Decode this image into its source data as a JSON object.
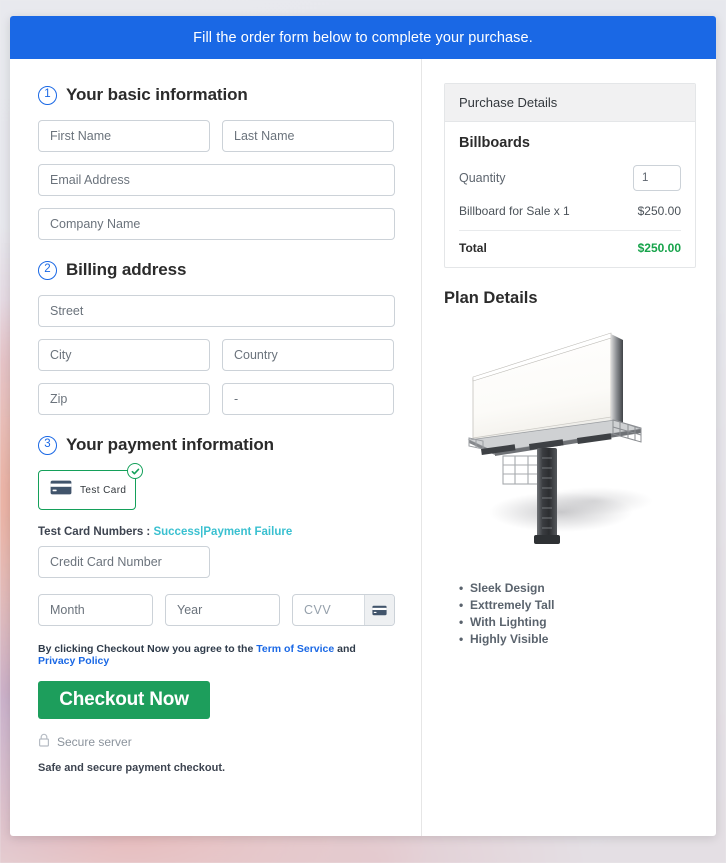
{
  "banner": {
    "text": "Fill the order form below to complete your purchase."
  },
  "sections": {
    "basic": {
      "number": "1",
      "title": "Your basic information",
      "fields": {
        "first_name": "First Name",
        "last_name": "Last Name",
        "email": "Email Address",
        "company": "Company Name"
      }
    },
    "billing": {
      "number": "2",
      "title": "Billing address",
      "fields": {
        "street": "Street",
        "city": "City",
        "country": "Country",
        "zip": "Zip",
        "state": "-"
      }
    },
    "payment": {
      "number": "3",
      "title": "Your payment information",
      "test_card_label": "Test Card",
      "test_card_icon": "credit-card-icon",
      "selected_icon": "check-circle-icon",
      "test_numbers_prefix": "Test Card Numbers :",
      "test_numbers_success": "Success",
      "test_numbers_separator": "|",
      "test_numbers_failure": "Payment Failure",
      "fields": {
        "card_number": "Credit Card Number",
        "month": "Month",
        "year": "Year",
        "cvv": "CVV"
      },
      "cvv_icon": "credit-card-icon"
    }
  },
  "footer": {
    "terms_prefix": "By clicking Checkout Now you agree to the",
    "terms_link": "Term of Service",
    "terms_middle": "and",
    "privacy_link": "Privacy Policy",
    "checkout_label": "Checkout Now",
    "secure_icon": "lock-icon",
    "secure_label": "Secure server",
    "safe_note": "Safe and secure payment checkout."
  },
  "purchase": {
    "header": "Purchase Details",
    "product_name": "Billboards",
    "quantity_label": "Quantity",
    "quantity_value": "1",
    "line_item_label": "Billboard for Sale x 1",
    "line_item_price": "$250.00",
    "total_label": "Total",
    "total_value": "$250.00"
  },
  "plan": {
    "title": "Plan Details",
    "image_name": "billboard-illustration",
    "features": [
      "Sleek Design",
      "Exttremely Tall",
      "With Lighting",
      "Highly Visible"
    ]
  },
  "colors": {
    "banner_blue": "#1a68e5",
    "accent_blue": "#1a68e5",
    "success_green": "#1d9e5c",
    "total_green": "#16a34a",
    "link_teal": "#3ac0d0",
    "card_border_green": "#14a05a"
  }
}
